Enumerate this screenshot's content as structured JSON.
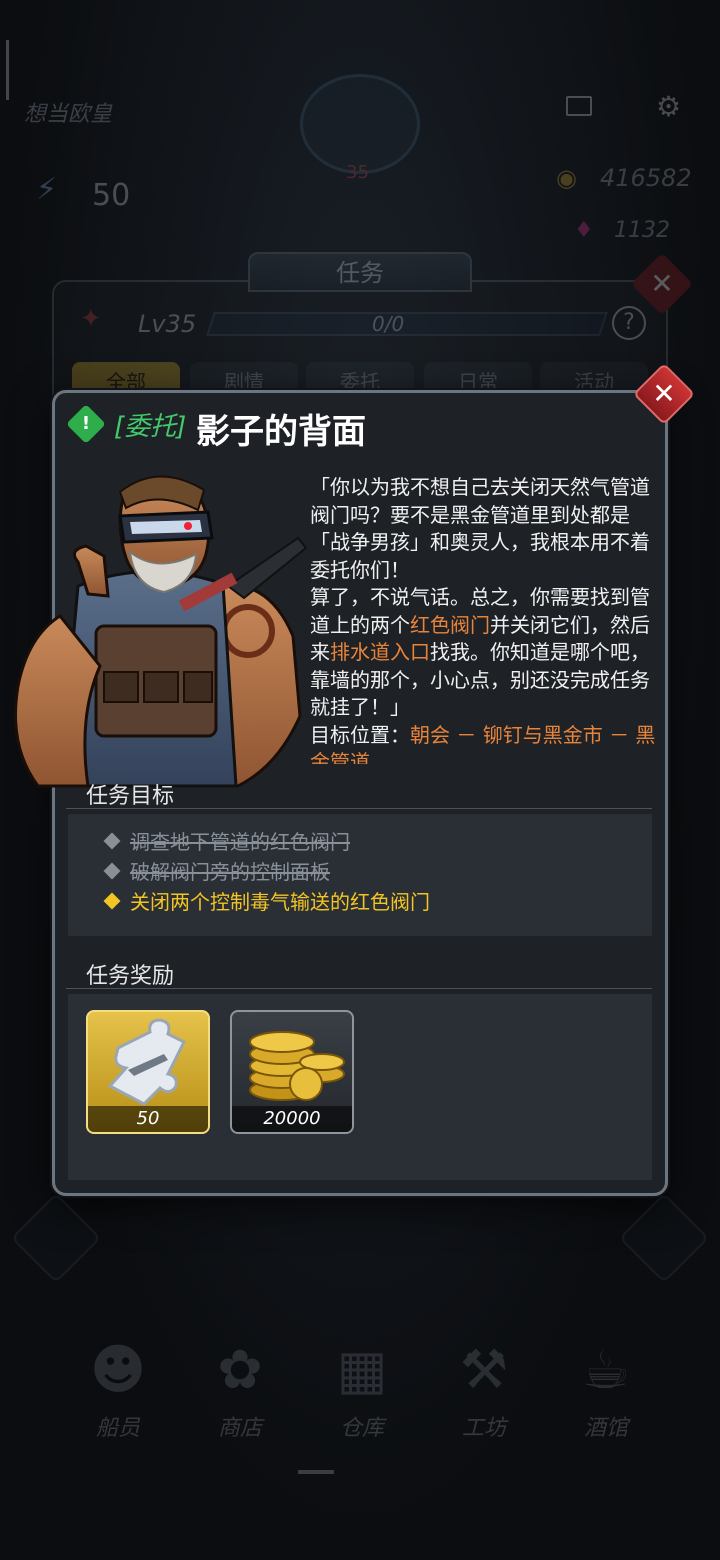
{
  "header": {
    "player_name": "想当欧皇",
    "avatar_level": "35",
    "energy": "50",
    "coins": "416582",
    "gems": "1132",
    "mail_icon": "mail-icon",
    "settings_icon": "gear-icon"
  },
  "task_panel": {
    "title": "任务",
    "level_label": "Lv35",
    "xp_text": "0/0",
    "xp_progress": 0,
    "tabs": [
      "全部",
      "剧情",
      "委托",
      "日常",
      "活动"
    ]
  },
  "quest": {
    "tag": "[委托]",
    "title": "影子的背面",
    "dialogue": {
      "p1": "「你以为我不想自己去关闭天然气管道阀门吗？要不是黑金管道里到处都是「战争男孩」和奥灵人，我根本用不着委托你们！",
      "p2_a": "算了，不说气话。总之，你需要找到管道上的两个",
      "p2_h1": "红色阀门",
      "p2_b": "并关闭它们，然后来",
      "p2_h2": "排水道入口",
      "p2_c": "找我。你知道是哪个吧，靠墙的那个，小心点，别还没完成任务就挂了！」",
      "loc_label": "目标位置：",
      "loc_value": "朝会 － 铆钉与黑金市 － 黑金管道"
    },
    "objectives_title": "任务目标",
    "objectives": [
      {
        "text": "调查地下管道的红色阀门",
        "status": "done"
      },
      {
        "text": "破解阀门旁的控制面板",
        "status": "done"
      },
      {
        "text": "关闭两个控制毒气输送的红色阀门",
        "status": "current"
      }
    ],
    "rewards_title": "任务奖励",
    "rewards": [
      {
        "icon": "puzzle-piece-icon",
        "count": "50"
      },
      {
        "icon": "gold-coins-icon",
        "count": "20000"
      }
    ]
  },
  "nav": {
    "items": [
      "船员",
      "商店",
      "仓库",
      "工坊",
      "酒馆"
    ]
  },
  "colors": {
    "highlight_orange": "#e8843a",
    "objective_yellow": "#f2c523",
    "quest_tag_green": "#43c96b",
    "close_red": "#c33333"
  }
}
